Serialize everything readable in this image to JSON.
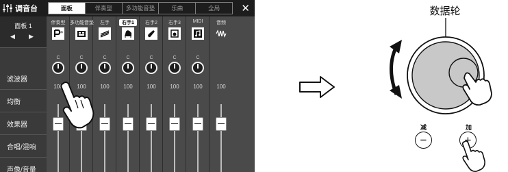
{
  "mixer": {
    "title": "调音台",
    "tabs": [
      {
        "label": "面板",
        "active": true
      },
      {
        "label": "伴奏型",
        "active": false
      },
      {
        "label": "多功能音垫",
        "active": false
      },
      {
        "label": "乐曲",
        "active": false
      },
      {
        "label": "全局",
        "active": false
      }
    ],
    "close_label": "✕",
    "panel_selector": {
      "label": "面板 1",
      "prev": "◀",
      "next": "▶"
    },
    "sidebar": [
      "滤波器",
      "均衡",
      "效果器",
      "合唱/混响",
      "声像/音量"
    ],
    "channels": [
      {
        "label": "伴奏型",
        "selected": false,
        "c": "C",
        "value": "100",
        "icon": "style-icon"
      },
      {
        "label": "多功能音垫",
        "selected": false,
        "c": "C",
        "value": "100",
        "icon": "multipad-icon"
      },
      {
        "label": "左手",
        "selected": false,
        "c": "C",
        "value": "100",
        "icon": "strings-icon"
      },
      {
        "label": "右手1",
        "selected": true,
        "c": "C",
        "value": "100",
        "icon": "piano-icon"
      },
      {
        "label": "右手2",
        "selected": false,
        "c": "C",
        "value": "100",
        "icon": "guitar-icon"
      },
      {
        "label": "右手3",
        "selected": false,
        "c": "C",
        "value": "100",
        "icon": "bass-icon"
      },
      {
        "label": "MIDI",
        "selected": false,
        "c": "C",
        "value": "100",
        "icon": "midi-note-icon"
      },
      {
        "label": "音频",
        "selected": false,
        "c": "",
        "value": "100",
        "icon": "audio-wave-icon"
      }
    ]
  },
  "dial": {
    "label": "数据轮",
    "dec_label": "减",
    "inc_label": "加",
    "dec_symbol": "−",
    "inc_symbol": "+"
  }
}
